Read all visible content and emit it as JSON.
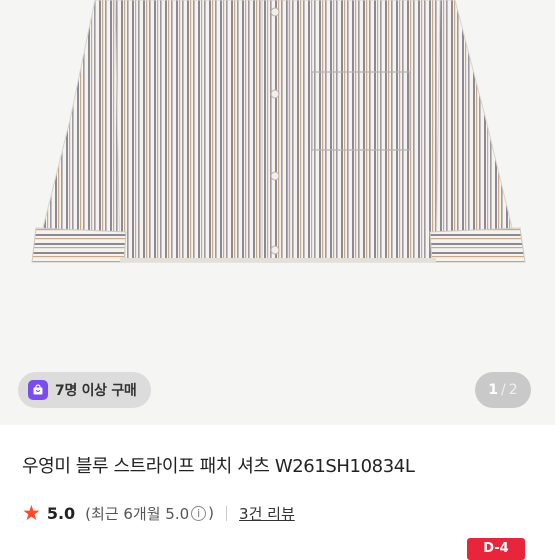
{
  "purchase_chip": {
    "label": "7명 이상 구매",
    "icon": "shopping-bag-icon",
    "color": "#7a4cf0"
  },
  "pager": {
    "current": "1",
    "separator": "/",
    "total": "2"
  },
  "product": {
    "title": "우영미 블루 스트라이프 패치 셔츠 W261SH10834L"
  },
  "rating": {
    "score": "5.0",
    "recent_open": "(최근 6개월 5.0",
    "recent_close": ")",
    "review_link": "3건 리뷰",
    "star_color": "#ff4a2a"
  },
  "badge": {
    "label": "D-4",
    "color": "#e8253a"
  }
}
